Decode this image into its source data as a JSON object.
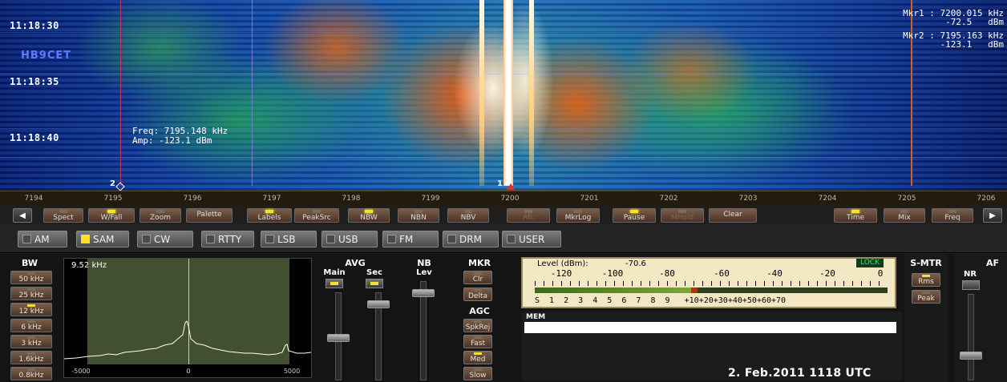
{
  "waterfall": {
    "times": [
      "11:18:30",
      "11:18:35",
      "11:18:40"
    ],
    "callsign": "HB9CET",
    "cursor_freq": "Freq: 7195.148  kHz",
    "cursor_amp": "Amp: -123.1  dBm",
    "mkr1_line1": "Mkr1 : 7200.015 kHz",
    "mkr1_line2": "-72.5   dBm",
    "mkr2_line1": "Mkr2 : 7195.163 kHz",
    "mkr2_line2": "-123.1   dBm",
    "marker2_tag": "2",
    "marker1_tag": "1"
  },
  "scale": {
    "labels": [
      "7194",
      "7195",
      "7196",
      "7197",
      "7198",
      "7199",
      "7200",
      "7201",
      "7202",
      "7203",
      "7204",
      "7205",
      "7206"
    ]
  },
  "toolbar": {
    "spect": "Spect",
    "wfall": "W/Fall",
    "zoom": "Zoom",
    "palette": "Palette",
    "labels": "Labels",
    "peaksrc": "PeakSrc",
    "nbw": "NBW",
    "nbn": "NBN",
    "nbv": "NBV",
    "afc": "Afc",
    "mkrlog": "MkrLog",
    "pause": "Pause",
    "mhold": "MHold",
    "clear": "Clear",
    "time": "Time",
    "mix": "Mix",
    "freq": "Freq",
    "left_arrow": "◀",
    "right_arrow": "▶"
  },
  "modes": {
    "am": "AM",
    "sam": "SAM",
    "cw": "CW",
    "rtty": "RTTY",
    "lsb": "LSB",
    "usb": "USB",
    "fm": "FM",
    "drm": "DRM",
    "user": "USER",
    "active": "SAM"
  },
  "bw": {
    "title": "BW",
    "current": "9.52 kHz",
    "options": [
      "50 kHz",
      "25 kHz",
      "12 kHz",
      "6 kHz",
      "3 kHz",
      "1.6kHz",
      "0.8kHz"
    ],
    "axis": [
      "-5000",
      "0",
      "5000"
    ]
  },
  "avg": {
    "title": "AVG",
    "main": "Main",
    "sec": "Sec"
  },
  "nb": {
    "title": "NB",
    "lev": "Lev"
  },
  "mkr": {
    "title": "MKR",
    "clr": "Clr",
    "delta": "Delta"
  },
  "agc": {
    "title": "AGC",
    "spkrej": "SpkRej",
    "fast": "Fast",
    "med": "Med",
    "slow": "Slow"
  },
  "meter": {
    "level_label": "Level (dBm):",
    "level_value": "-70.6",
    "lock": "LOCK",
    "dbm_scale": [
      "-120",
      "-100",
      "-80",
      "-60",
      "-40",
      "-20",
      "0"
    ],
    "s_scale": "S  1  2  3  4  5  6  7  8  9   +10+20+30+40+50+60+70",
    "level_dbm": -70.6
  },
  "mem": {
    "title": "MEM",
    "datetime": "2. Feb.2011 1118 UTC"
  },
  "smtr": {
    "title": "S-MTR",
    "rms": "Rms",
    "peak": "Peak"
  },
  "af": {
    "title": "AF",
    "nr": "NR"
  },
  "colors": {
    "led_on": "#f8e030",
    "lock_green": "#3ee060",
    "meter_bg": "#f4e8c4"
  }
}
